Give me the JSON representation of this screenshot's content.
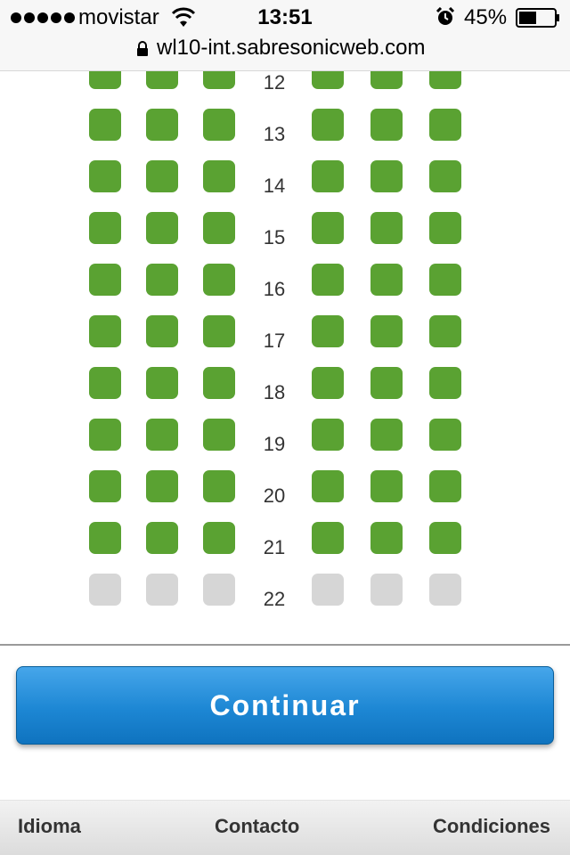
{
  "status_bar": {
    "carrier": "movistar",
    "time": "13:51",
    "battery_percent": "45%",
    "signal_icon": "signal-dots-icon",
    "wifi_icon": "wifi-icon",
    "alarm_icon": "alarm-clock-icon",
    "battery_icon": "battery-icon"
  },
  "url_bar": {
    "url": "wl10-int.sabresonicweb.com",
    "lock_icon": "lock-icon"
  },
  "seat_map": {
    "colors": {
      "available": "#5aa232",
      "unavailable": "#d6d6d6"
    },
    "rows": [
      {
        "number": "12",
        "seats": [
          "available",
          "available",
          "available",
          "available",
          "available",
          "available"
        ]
      },
      {
        "number": "13",
        "seats": [
          "available",
          "available",
          "available",
          "available",
          "available",
          "available"
        ]
      },
      {
        "number": "14",
        "seats": [
          "available",
          "available",
          "available",
          "available",
          "available",
          "available"
        ]
      },
      {
        "number": "15",
        "seats": [
          "available",
          "available",
          "available",
          "available",
          "available",
          "available"
        ]
      },
      {
        "number": "16",
        "seats": [
          "available",
          "available",
          "available",
          "available",
          "available",
          "available"
        ]
      },
      {
        "number": "17",
        "seats": [
          "available",
          "available",
          "available",
          "available",
          "available",
          "available"
        ]
      },
      {
        "number": "18",
        "seats": [
          "available",
          "available",
          "available",
          "available",
          "available",
          "available"
        ]
      },
      {
        "number": "19",
        "seats": [
          "available",
          "available",
          "available",
          "available",
          "available",
          "available"
        ]
      },
      {
        "number": "20",
        "seats": [
          "available",
          "available",
          "available",
          "available",
          "available",
          "available"
        ]
      },
      {
        "number": "21",
        "seats": [
          "available",
          "available",
          "available",
          "available",
          "available",
          "available"
        ]
      },
      {
        "number": "22",
        "seats": [
          "unavailable",
          "unavailable",
          "unavailable",
          "unavailable",
          "unavailable",
          "unavailable"
        ]
      }
    ]
  },
  "continue_button": {
    "label": "Continuar",
    "color": "#1d87d4"
  },
  "footer": {
    "links": [
      {
        "label": "Idioma"
      },
      {
        "label": "Contacto"
      },
      {
        "label": "Condiciones"
      }
    ]
  }
}
